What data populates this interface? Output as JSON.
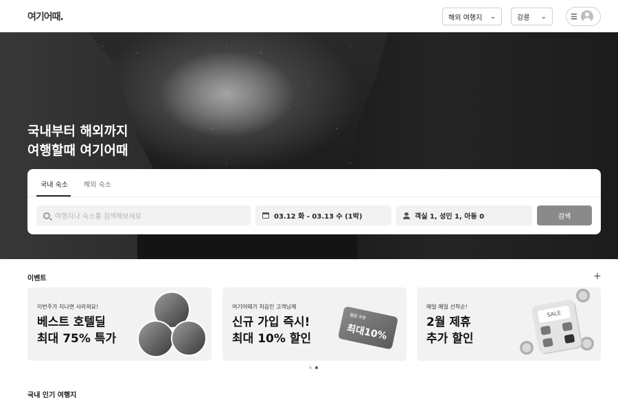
{
  "header": {
    "logo": "여기어때.",
    "destination_select": "해외 여행지",
    "city_select": "강릉"
  },
  "hero": {
    "title_line1": "국내부터 해외까지",
    "title_line2": "여행할때 여기어때"
  },
  "search": {
    "tabs": [
      "국내 숙소",
      "해외 숙소"
    ],
    "active_tab": 0,
    "keyword_placeholder": "여행지나 숙소를 검색해보세요",
    "dates": "03.12 화 - 03.13 수 (1박)",
    "guests": "객실 1, 성인 1, 아동 0",
    "search_button": "검색"
  },
  "events": {
    "title": "이벤트",
    "cards": [
      {
        "subtitle": "이번주가 지나면 사라져요!",
        "headline1": "베스트 호텔딜",
        "headline2": "최대 75% 특가"
      },
      {
        "subtitle": "여기어때가 처음인 고객님께",
        "headline1": "신규 가입 즉시!",
        "headline2": "최대 10% 할인",
        "coupon_tag": "웰컴 쿠폰",
        "coupon_value": "최대10%"
      },
      {
        "subtitle": "매일 매일 선착순!",
        "headline1": "2월 제휴",
        "headline2": "추가 할인",
        "calc_screen": "SALE"
      }
    ],
    "carousel": {
      "pages": 2,
      "current": 2
    }
  },
  "popular": {
    "title": "국내 인기 여행지"
  },
  "icons": [
    "chevron-down-icon",
    "menu-icon",
    "avatar-icon",
    "search-icon",
    "calendar-icon",
    "person-icon",
    "plus-icon"
  ]
}
